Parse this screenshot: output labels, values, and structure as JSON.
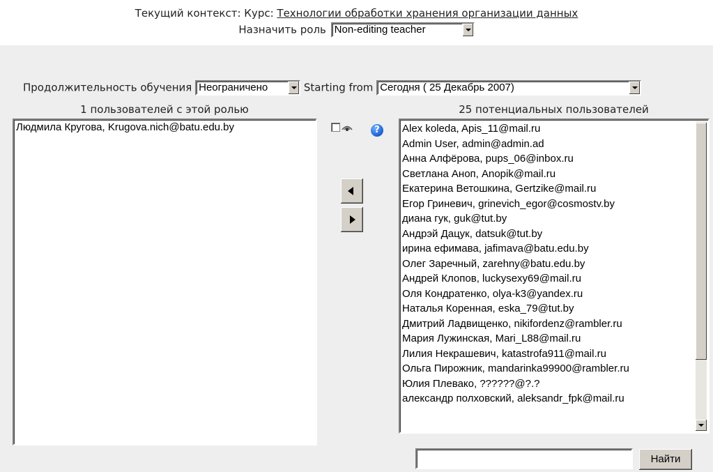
{
  "header": {
    "context_label": "Текущий контекст: Курс: ",
    "context_link": "Технологии обработки хранения организации данных",
    "assign_role_label": "Назначить роль",
    "role_selected": "Non-editing teacher"
  },
  "enrol": {
    "duration_label": "Продолжительность обучения",
    "duration_value": "Неограничено",
    "starting_from_label": "Starting from",
    "starting_from_value": "Сегодня ( 25 Декабрь 2007)"
  },
  "existing": {
    "heading": "1 пользователей с этой ролью",
    "users": [
      "Людмила Кругова, Krugova.nich@batu.edu.by"
    ]
  },
  "potential": {
    "heading": "25 потенциальных пользователей",
    "users": [
      "Alex koleda, Apis_11@mail.ru",
      "Admin User, admin@admin.ad",
      "Анна Алфёрова, pups_06@inbox.ru",
      "Светлана Аноп, Anopik@mail.ru",
      "Екатерина Ветошкина, Gertzike@mail.ru",
      "Егор Гриневич, grinevich_egor@cosmostv.by",
      "диана гук, guk@tut.by",
      "Андрэй Дацук, datsuk@tut.by",
      "ирина ефимава, jafimava@batu.edu.by",
      "Олег Заречный, zarehny@batu.edu.by",
      "Андрей Клопов, luckysexy69@mail.ru",
      "Оля Кондратенко, olya-k3@yandex.ru",
      "Наталья Коренная, eska_79@tut.by",
      "Дмитрий Ладвищенко, nikifordenz@rambler.ru",
      "Мария Лужинская, Mari_L88@mail.ru",
      "Лилия Некрашевич, katastrofa911@mail.ru",
      "Ольга Пирожник, mandarinka99900@rambler.ru",
      "Юлия Плевако, ??????@?.?",
      "александр полховский, aleksandr_fpk@mail.ru"
    ]
  },
  "search": {
    "value": "",
    "button_label": "Найти"
  },
  "icons": {
    "help": "help-icon",
    "eye": "eye-icon",
    "add": "arrow-left-icon",
    "remove": "arrow-right-icon"
  }
}
